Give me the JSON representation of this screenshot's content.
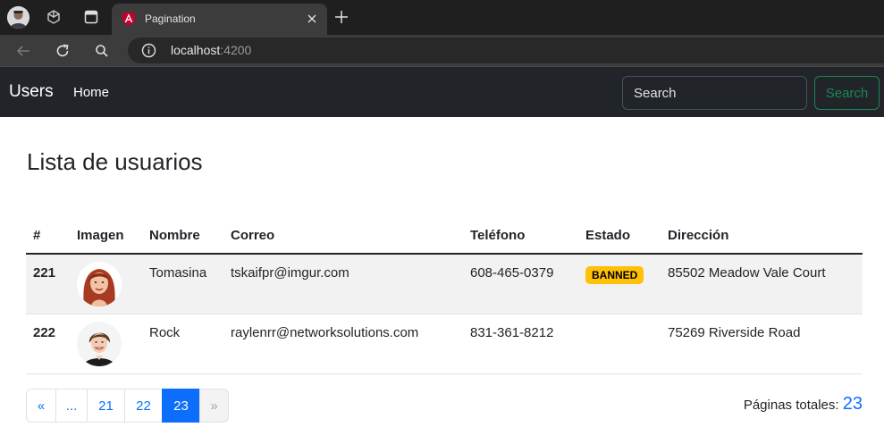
{
  "browser": {
    "tab_title": "Pagination",
    "url_host": "localhost",
    "url_port": ":4200"
  },
  "navbar": {
    "brand": "Users",
    "home": "Home",
    "search_placeholder": "Search",
    "search_button": "Search"
  },
  "page": {
    "title": "Lista de usuarios"
  },
  "table": {
    "headers": [
      "#",
      "Imagen",
      "Nombre",
      "Correo",
      "Teléfono",
      "Estado",
      "Dirección"
    ],
    "rows": [
      {
        "id": "221",
        "image": "avatar-red-hair",
        "name": "Tomasina",
        "email": "tskaifpr@imgur.com",
        "phone": "608-465-0379",
        "status": "BANNED",
        "address": "85502 Meadow Vale Court"
      },
      {
        "id": "222",
        "image": "avatar-smiling-woman",
        "name": "Rock",
        "email": "raylenrr@networksolutions.com",
        "phone": "831-361-8212",
        "status": "",
        "address": "75269 Riverside Road"
      }
    ]
  },
  "pagination": {
    "first": "«",
    "ellipsis": "...",
    "pages": [
      "21",
      "22",
      "23"
    ],
    "current": "23",
    "next": "»"
  },
  "total": {
    "label": "Páginas totales:",
    "value": "23"
  },
  "colors": {
    "primary": "#0d6efd",
    "navbar_bg": "#212529",
    "success_outline": "#198754",
    "badge_warning": "#ffc107"
  }
}
